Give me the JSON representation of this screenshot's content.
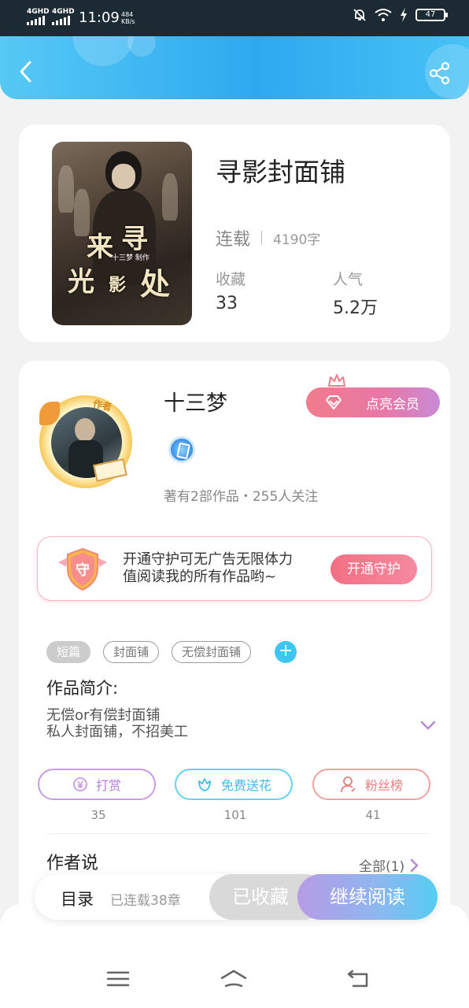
{
  "status_bar": {
    "network_1": "4GHD",
    "network_2": "4GHD",
    "time": "11:09",
    "speed_value": "484",
    "speed_unit": "KB/s",
    "battery": "47",
    "icons": [
      "mute-bell-icon",
      "wifi-icon",
      "charging-bolt-icon",
      "battery-icon"
    ]
  },
  "header": {
    "back_icon": "chevron-left-icon",
    "share_icon": "share-icon",
    "accent_colors": [
      "#56c9f5",
      "#2ea9f0"
    ]
  },
  "book": {
    "title": "寻影封面铺",
    "status": "连载",
    "word_count": "4190字",
    "favorites_label": "收藏",
    "favorites_value": "33",
    "popularity_label": "人气",
    "popularity_value": "5.2万",
    "cover_text": {
      "line1a": "来",
      "line1b": "寻",
      "line2a": "光",
      "line2b": "影",
      "line2c": "处",
      "credit": "十三梦 制作"
    }
  },
  "author": {
    "name": "十三梦",
    "avatar_tag": "作者",
    "member_button": "点亮会员",
    "meta": "著有2部作品・255人关注"
  },
  "guard": {
    "shield_text": "守",
    "text": "开通守护可无广告无限体力值阅读我的所有作品哟~",
    "button": "开通守护"
  },
  "tags": [
    "短篇",
    "封面铺",
    "无偿封面铺"
  ],
  "tag_add": "+",
  "intro": {
    "title": "作品简介:",
    "line1": "无偿or有偿封面铺",
    "line2": "私人封面铺，不招美工"
  },
  "actions": {
    "tip_label": "打赏",
    "tip_count": "35",
    "flower_label": "免费送花",
    "flower_count": "101",
    "fans_label": "粉丝榜",
    "fans_count": "41"
  },
  "author_says": {
    "title": "作者说",
    "all_link": "全部(1)"
  },
  "read_bar": {
    "catalog": "目录",
    "chapters": "已连载38章",
    "favorited": "已收藏",
    "continue": "继续阅读"
  },
  "nav_bar": {
    "icons": [
      "menu-icon",
      "home-icon",
      "back-nav-icon"
    ]
  }
}
